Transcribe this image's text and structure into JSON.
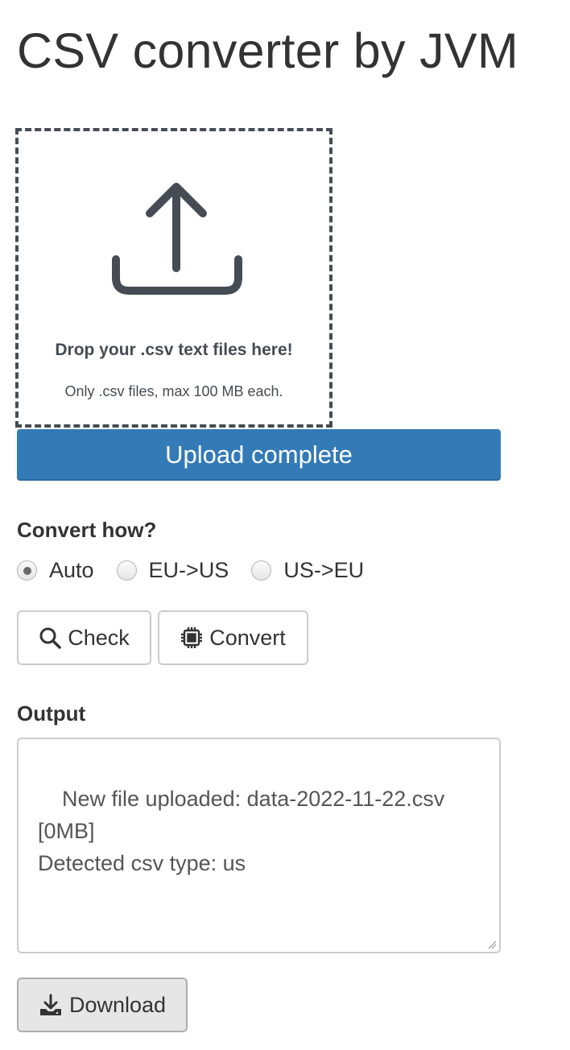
{
  "page": {
    "title": "CSV converter by JVM"
  },
  "dropzone": {
    "icon": "upload-icon",
    "title": "Drop your .csv text files here!",
    "subtitle": "Only .csv files, max 100 MB each."
  },
  "upload_status": {
    "label": "Upload complete",
    "progress_percent": 100,
    "color": "#337ab7"
  },
  "convert": {
    "label": "Convert how?",
    "options": [
      {
        "label": "Auto",
        "checked": true
      },
      {
        "label": "EU->US",
        "checked": false
      },
      {
        "label": "US->EU",
        "checked": false
      }
    ]
  },
  "actions": {
    "check": {
      "label": "Check",
      "icon": "search-icon"
    },
    "convert": {
      "label": "Convert",
      "icon": "cpu-chip-icon"
    }
  },
  "output": {
    "label": "Output",
    "value": "New file uploaded: data-2022-11-22.csv\n[0MB]\nDetected csv type: us"
  },
  "download": {
    "label": "Download",
    "icon": "download-icon"
  }
}
